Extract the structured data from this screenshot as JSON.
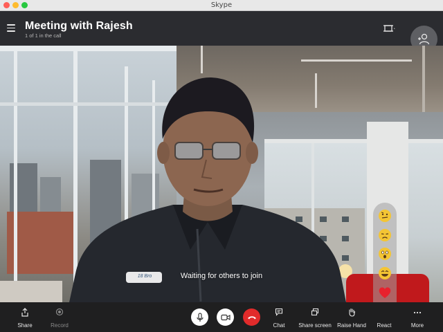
{
  "window": {
    "title": "Skype"
  },
  "header": {
    "meeting_title": "Meeting with Rajesh",
    "participants": "1 of 1 in the call"
  },
  "video": {
    "status": "Waiting for others to join",
    "shirt_tag": "18 Bro"
  },
  "reactions": [
    {
      "name": "thinking-emoji-icon"
    },
    {
      "name": "sad-emoji-icon"
    },
    {
      "name": "surprised-emoji-icon"
    },
    {
      "name": "laughing-emoji-icon"
    },
    {
      "name": "heart-emoji-icon"
    },
    {
      "name": "thumbs-up-emoji-icon"
    }
  ],
  "toolbar": {
    "share": "Share",
    "record": "Record",
    "chat": "Chat",
    "share_screen": "Share screen",
    "raise_hand": "Raise Hand",
    "react": "React",
    "more": "More"
  },
  "colors": {
    "header_bg": "#2b2c30",
    "toolbar_bg": "#1f1f20",
    "hangup_red": "#e12b2b",
    "emoji_yellow": "#f4c534",
    "heart_red": "#e8212d"
  }
}
